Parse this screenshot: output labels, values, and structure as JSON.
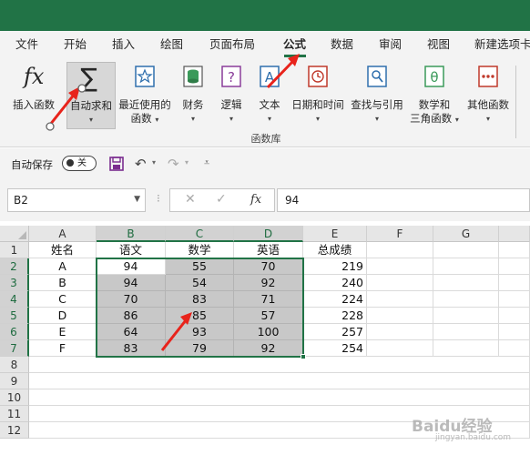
{
  "ribbon_tabs": [
    {
      "label": "文件",
      "active": false
    },
    {
      "label": "开始",
      "active": false
    },
    {
      "label": "插入",
      "active": false
    },
    {
      "label": "绘图",
      "active": false
    },
    {
      "label": "页面布局",
      "active": false
    },
    {
      "label": "公式",
      "active": true
    },
    {
      "label": "数据",
      "active": false
    },
    {
      "label": "审阅",
      "active": false
    },
    {
      "label": "视图",
      "active": false
    },
    {
      "label": "新建选项卡",
      "active": false
    }
  ],
  "ribbon": {
    "insert_function": "插入函数",
    "autosum": "自动求和",
    "recent": [
      "最近使用的",
      "函数"
    ],
    "financial": "财务",
    "logical": "逻辑",
    "text": "文本",
    "datetime": "日期和时间",
    "lookup": "查找与引用",
    "mathtrig": [
      "数学和",
      "三角函数"
    ],
    "more": "其他函数",
    "group_label": "函数库"
  },
  "qat": {
    "autosave_label": "自动保存",
    "autosave_state": "关"
  },
  "formula_bar": {
    "name_box": "B2",
    "fx": "fx",
    "value": "94"
  },
  "sheet": {
    "columns": [
      "A",
      "B",
      "C",
      "D",
      "E",
      "F",
      "G"
    ],
    "rows": [
      "1",
      "2",
      "3",
      "4",
      "5",
      "6",
      "7",
      "8",
      "9",
      "10",
      "11",
      "12"
    ],
    "headers": [
      "姓名",
      "语文",
      "数学",
      "英语",
      "总成绩"
    ],
    "data": [
      {
        "name": "A",
        "chinese": "94",
        "math": "55",
        "english": "70",
        "total": "219"
      },
      {
        "name": "B",
        "chinese": "94",
        "math": "54",
        "english": "92",
        "total": "240"
      },
      {
        "name": "C",
        "chinese": "70",
        "math": "83",
        "english": "71",
        "total": "224"
      },
      {
        "name": "D",
        "chinese": "86",
        "math": "85",
        "english": "57",
        "total": "228"
      },
      {
        "name": "E",
        "chinese": "64",
        "math": "93",
        "english": "100",
        "total": "257"
      },
      {
        "name": "F",
        "chinese": "83",
        "math": "79",
        "english": "92",
        "total": "254"
      }
    ]
  },
  "watermark": {
    "main": "Baidu经验",
    "sub": "jingyan.baidu.com"
  },
  "colors": {
    "accent": "#217346",
    "annotation": "#e8231b",
    "selection_fill": "#c8c8c8"
  },
  "icons": [
    "fx-icon",
    "sigma-icon",
    "star-icon",
    "database-icon",
    "question-icon",
    "text-a-icon",
    "clock-icon",
    "search-doc-icon",
    "theta-icon",
    "dots-icon",
    "save-icon",
    "undo-icon",
    "redo-icon"
  ]
}
